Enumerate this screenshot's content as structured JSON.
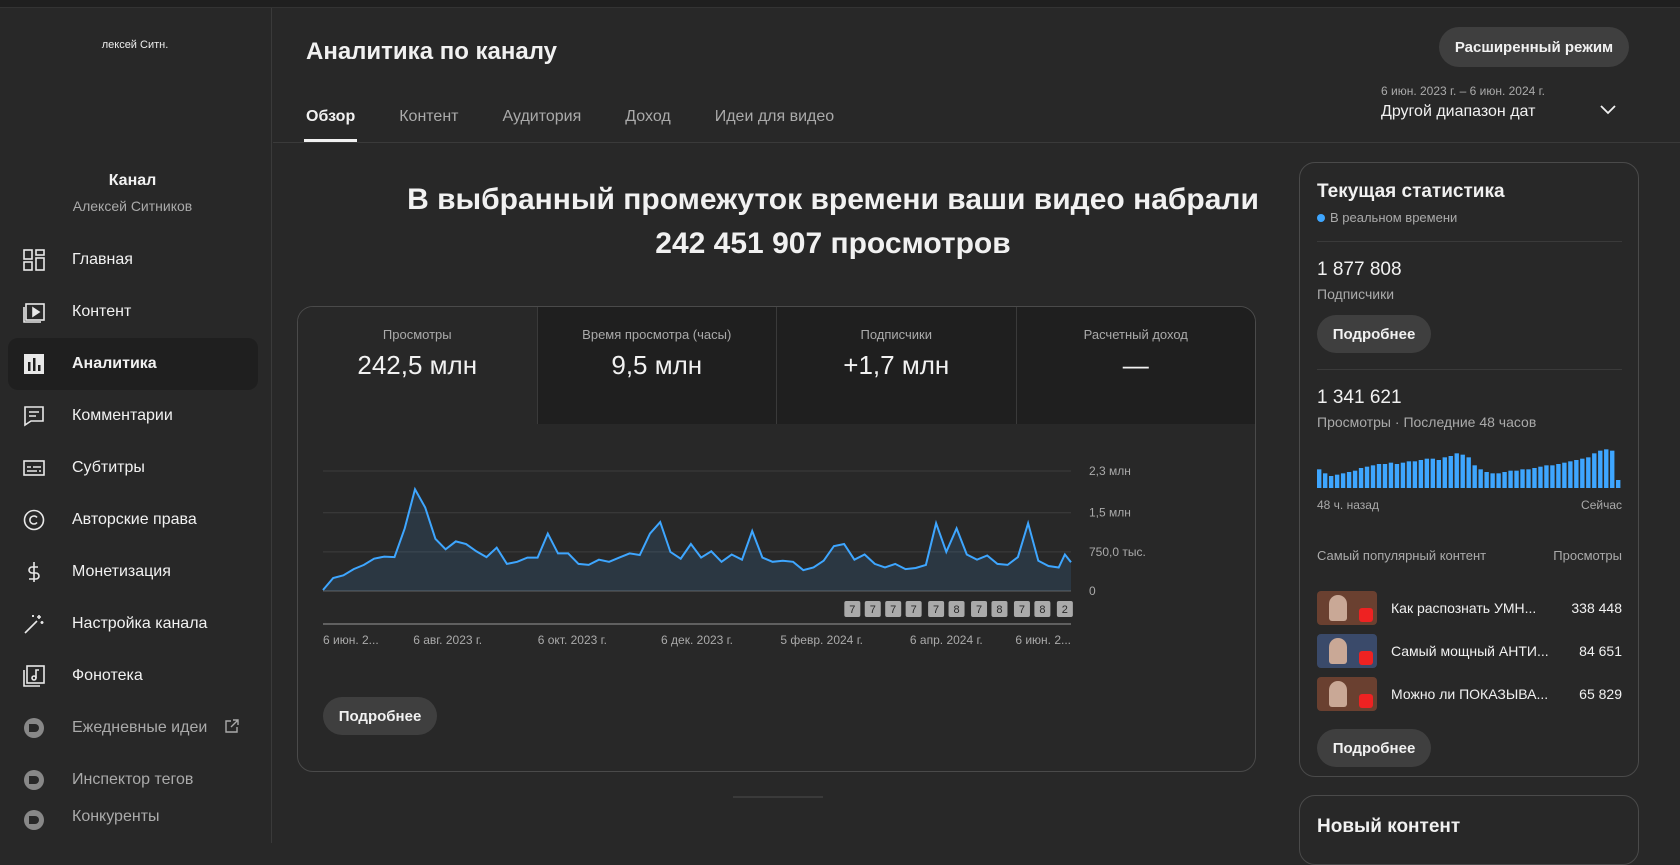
{
  "sidebar": {
    "avatar_text": "лексей Ситн.",
    "channel_title": "Канал",
    "channel_name": "Алексей Ситников",
    "items": [
      {
        "label": "Главная",
        "icon": "dashboard-icon"
      },
      {
        "label": "Контент",
        "icon": "video-content-icon"
      },
      {
        "label": "Аналитика",
        "icon": "analytics-icon",
        "active": true
      },
      {
        "label": "Комментарии",
        "icon": "comments-icon"
      },
      {
        "label": "Субтитры",
        "icon": "subtitles-icon"
      },
      {
        "label": "Авторские права",
        "icon": "copyright-icon"
      },
      {
        "label": "Монетизация",
        "icon": "dollar-icon"
      },
      {
        "label": "Настройка канала",
        "icon": "magic-wand-icon"
      },
      {
        "label": "Фонотека",
        "icon": "audio-library-icon"
      },
      {
        "label": "Ежедневные идеи",
        "icon": "plugin-icon",
        "external": true
      },
      {
        "label": "Инспектор тегов",
        "icon": "plugin-icon"
      },
      {
        "label": "Конкуренты",
        "icon": "plugin-icon"
      }
    ]
  },
  "header": {
    "title": "Аналитика по каналу",
    "advanced_button": "Расширенный режим",
    "tabs": [
      "Обзор",
      "Контент",
      "Аудитория",
      "Доход",
      "Идеи для видео"
    ],
    "date_range_sub": "6 июн. 2023 г. – 6 июн. 2024 г.",
    "date_range_main": "Другой диапазон дат"
  },
  "headline": {
    "line1": "В выбранный промежуток времени ваши видео набрали",
    "line2": "242 451 907 просмотров"
  },
  "metrics": [
    {
      "label": "Просмотры",
      "value": "242,5 млн"
    },
    {
      "label": "Время просмотра (часы)",
      "value": "9,5 млн"
    },
    {
      "label": "Подписчики",
      "value": "+1,7 млн"
    },
    {
      "label": "Расчетный доход",
      "value": "—"
    }
  ],
  "chart_more_button": "Подробнее",
  "chart_data": {
    "type": "area",
    "y_tick_labels": [
      "2,3 млн",
      "1,5 млн",
      "750,0 тыс.",
      "0"
    ],
    "y_ticks": [
      2300000,
      1500000,
      750000,
      0
    ],
    "ylim": [
      0,
      2300000
    ],
    "x_tick_labels": [
      "6 июн. 2...",
      "6 авг. 2023 г.",
      "6 окт. 2023 г.",
      "6 дек. 2023 г.",
      "5 февр. 2024 г.",
      "6 апр. 2024 г.",
      "6 июн. 2..."
    ],
    "x_tick_days": [
      0,
      61,
      122,
      183,
      244,
      305,
      366
    ],
    "marker_labels": [
      "7",
      "7",
      "7",
      "7",
      "7",
      "8",
      "7",
      "8",
      "7",
      "8",
      "2"
    ],
    "marker_days": [
      259,
      269,
      279,
      289,
      300,
      310,
      321,
      331,
      342,
      352,
      363
    ],
    "series": [
      {
        "x_days": [
          0,
          5,
          10,
          15,
          20,
          25,
          30,
          35,
          40,
          45,
          50,
          55,
          60,
          65,
          70,
          75,
          80,
          85,
          90,
          95,
          100,
          105,
          110,
          115,
          120,
          125,
          130,
          135,
          140,
          145,
          150,
          155,
          160,
          165,
          170,
          175,
          180,
          185,
          190,
          195,
          200,
          205,
          210,
          215,
          220,
          225,
          230,
          235,
          240,
          245,
          250,
          255,
          260,
          265,
          270,
          275,
          280,
          285,
          290,
          295,
          300,
          305,
          310,
          315,
          320,
          325,
          330,
          335,
          340,
          345,
          350,
          355,
          360,
          363,
          366
        ],
        "values": [
          20000,
          250000,
          300000,
          420000,
          500000,
          620000,
          660000,
          650000,
          1200000,
          1950000,
          1600000,
          1000000,
          800000,
          950000,
          900000,
          760000,
          650000,
          830000,
          520000,
          560000,
          640000,
          640000,
          1100000,
          720000,
          720000,
          520000,
          500000,
          600000,
          560000,
          640000,
          720000,
          690000,
          1100000,
          1320000,
          750000,
          620000,
          900000,
          640000,
          760000,
          560000,
          700000,
          600000,
          1150000,
          640000,
          560000,
          580000,
          560000,
          400000,
          450000,
          580000,
          860000,
          900000,
          600000,
          700000,
          520000,
          450000,
          520000,
          420000,
          440000,
          500000,
          1300000,
          750000,
          1200000,
          700000,
          600000,
          680000,
          520000,
          500000,
          650000,
          1300000,
          580000,
          480000,
          450000,
          700000,
          550000
        ]
      }
    ],
    "accent_color": "#3ea6ff"
  },
  "realtime": {
    "title": "Текущая статистика",
    "live_label": "В реальном времени",
    "subscribers_value": "1 877 808",
    "subscribers_label": "Подписчики",
    "more_button_1": "Подробнее",
    "views_value": "1 341 621",
    "views_label": "Просмотры · Последние 48 часов",
    "bars_left": "48 ч. назад",
    "bars_right": "Сейчас",
    "bars": [
      14,
      11,
      9,
      10,
      11,
      12,
      13,
      15,
      16,
      17,
      18,
      18,
      19,
      18,
      19,
      20,
      20,
      21,
      22,
      22,
      21,
      23,
      24,
      26,
      25,
      23,
      17,
      14,
      12,
      11,
      11,
      12,
      13,
      13,
      14,
      14,
      15,
      16,
      17,
      17,
      18,
      19,
      20,
      21,
      22,
      23,
      26,
      28,
      29,
      28,
      6
    ],
    "popular_head_left": "Самый популярный контент",
    "popular_head_right": "Просмотры",
    "popular": [
      {
        "title": "Как распознать УМН...",
        "views": "338 448"
      },
      {
        "title": "Самый мощный АНТИ...",
        "views": "84 651"
      },
      {
        "title": "Можно ли ПОКАЗЫВА...",
        "views": "65 829"
      }
    ],
    "more_button_2": "Подробнее"
  },
  "new_content": {
    "title": "Новый контент"
  }
}
